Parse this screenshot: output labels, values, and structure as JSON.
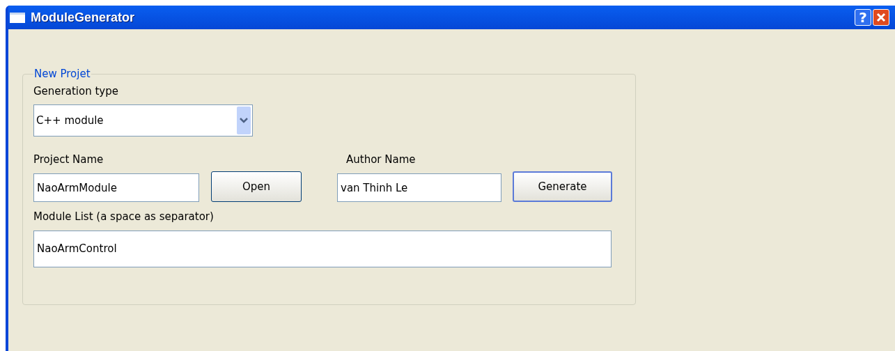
{
  "window": {
    "title": "ModuleGenerator",
    "help_button": "?"
  },
  "group": {
    "title": "New Projet",
    "generation_type": {
      "label": "Generation type",
      "value": "C++ module"
    },
    "project_name": {
      "label": "Project Name",
      "value": "NaoArmModule"
    },
    "open_button": "Open",
    "author_name": {
      "label": "Author Name",
      "value": "van Thinh Le"
    },
    "generate_button": "Generate",
    "module_list": {
      "label": "Module List (a space as separator)",
      "value": "NaoArmControl"
    }
  }
}
